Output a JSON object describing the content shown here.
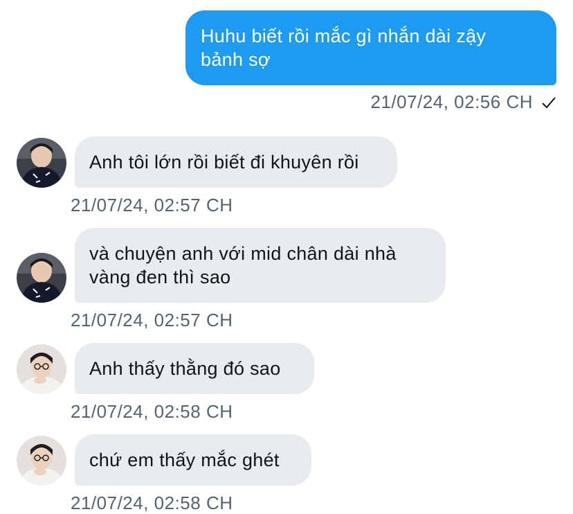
{
  "conversation": {
    "messages": [
      {
        "direction": "outgoing",
        "text": "Huhu biết rồi mắc gì nhắn dài zậy\nbảnh sợ",
        "time": "21/07/24, 02:56 CH",
        "status_icon": "check-icon"
      },
      {
        "direction": "incoming",
        "avatar": "avatar-dark-jersey",
        "text": "Anh tôi lớn rồi biết đi khuyên rồi",
        "time": "21/07/24, 02:57 CH"
      },
      {
        "direction": "incoming",
        "avatar": "avatar-dark-jersey",
        "text": "và chuyện anh với mid chân dài nhà\nvàng đen thì sao",
        "time": "21/07/24, 02:57 CH"
      },
      {
        "direction": "incoming",
        "avatar": "avatar-glasses",
        "text": "Anh thấy thằng đó sao",
        "time": "21/07/24, 02:58 CH"
      },
      {
        "direction": "incoming",
        "avatar": "avatar-glasses",
        "text": "chứ em thấy mắc ghét",
        "time": "21/07/24, 02:58 CH"
      }
    ]
  },
  "colors": {
    "outgoing_bubble": "#1d9bf0",
    "incoming_bubble": "#e8ecef",
    "timestamp": "#536471",
    "text": "#0f1419"
  }
}
